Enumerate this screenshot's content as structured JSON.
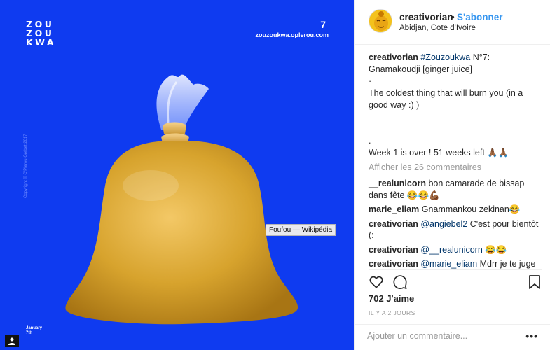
{
  "image": {
    "logo_lines": [
      "ZOU",
      "ZOU",
      "KWA"
    ],
    "issue_number": "7",
    "site_url": "zouzoukwa.oplerou.com",
    "copyright": "Copyright © O'Plerou Grebet 2017",
    "date_lines": [
      "January",
      "7th"
    ],
    "tooltip": "Foufou — Wikipédia",
    "background_color": "#0f3bf0"
  },
  "header": {
    "username": "creativorian",
    "separator": "•",
    "follow_label": "S'abonner",
    "location": "Abidjan, Cote d'Ivoire"
  },
  "caption": {
    "username": "creativorian",
    "hashtag": "#Zouzoukwa",
    "line1_rest": " N°7:",
    "line2": "Gnamakoudji [ginger juice]",
    "line3": "·",
    "line4": "The coldest thing that will burn you (in a good way :) )",
    "line5": ".",
    "line6": "Week 1 is over ! 51 weeks left 🙏🏾🙏🏾"
  },
  "view_all_comments": "Afficher les 26 commentaires",
  "comments": [
    {
      "user": "__realunicorn",
      "mention": "",
      "text": " bon camarade de bissap dans fête 😂😂💪🏾"
    },
    {
      "user": "marie_eliam",
      "mention": "",
      "text": " Gnammankou zekinan😂"
    },
    {
      "user": "creativorian",
      "mention": "@angiebel2",
      "text": " C'est pour bientôt (:"
    },
    {
      "user": "creativorian",
      "mention": "@__realunicorn",
      "text": " 😂😂"
    },
    {
      "user": "creativorian",
      "mention": "@marie_eliam",
      "text": " Mdrr je te juge"
    }
  ],
  "actions": {
    "like_icon": "heart-icon",
    "comment_icon": "comment-bubble-icon",
    "save_icon": "bookmark-icon"
  },
  "likes": "702 J'aime",
  "timestamp": "IL Y A 2 JOURS",
  "add_comment": {
    "placeholder": "Ajouter un commentaire...",
    "more_label": "•••"
  },
  "colors": {
    "link_blue": "#3897f0",
    "mention_blue": "#003569",
    "muted": "#999999",
    "text": "#262626"
  }
}
